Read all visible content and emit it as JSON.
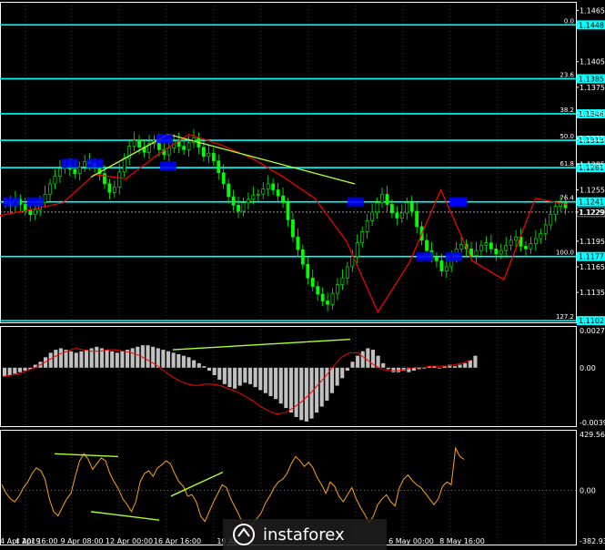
{
  "chart_data": [
    {
      "type": "candlestick",
      "ylim": [
        1.11,
        1.1475
      ],
      "price_ticks": [
        "1.1465",
        "1.1405",
        "1.1375",
        "1.1345",
        "1.1315",
        "1.1285",
        "1.1255",
        "1.1229",
        "1.1195",
        "1.1165",
        "1.1135"
      ],
      "fib_levels": [
        {
          "label": "0.0",
          "value": 1.1448,
          "price": "1.1448"
        },
        {
          "label": "23.6",
          "value": 1.1385,
          "price": "1.1385"
        },
        {
          "label": "38.2",
          "value": 1.1344,
          "price": "1.1344"
        },
        {
          "label": "50.0",
          "value": 1.1313,
          "price": "1.1313"
        },
        {
          "label": "61.8",
          "value": 1.1281,
          "price": "1.1281"
        },
        {
          "label": "76.4",
          "value": 1.1241,
          "price": "1.1241"
        },
        {
          "label": "100.0",
          "value": 1.1177,
          "price": "1.1177"
        },
        {
          "label": "127.2",
          "value": 1.1102,
          "price": "1.1102"
        }
      ],
      "current_price": {
        "value": 1.1229,
        "label": "1.1229"
      },
      "close_series": [
        1.124,
        1.1236,
        1.1244,
        1.1238,
        1.1231,
        1.1226,
        1.1232,
        1.124,
        1.125,
        1.1262,
        1.1271,
        1.128,
        1.1284,
        1.1279,
        1.1274,
        1.1282,
        1.1288,
        1.1286,
        1.1281,
        1.1274,
        1.1262,
        1.1252,
        1.1258,
        1.1276,
        1.1292,
        1.1306,
        1.1313,
        1.1305,
        1.1299,
        1.1309,
        1.1313,
        1.1302,
        1.1296,
        1.1304,
        1.1312,
        1.1306,
        1.1302,
        1.131,
        1.1316,
        1.1305,
        1.1294,
        1.1298,
        1.1289,
        1.1275,
        1.1262,
        1.1247,
        1.1237,
        1.123,
        1.124,
        1.1244,
        1.1249,
        1.125,
        1.1256,
        1.1262,
        1.1255,
        1.1248,
        1.124,
        1.122,
        1.12,
        1.1185,
        1.1168,
        1.1152,
        1.1142,
        1.1133,
        1.1125,
        1.1121,
        1.1134,
        1.1144,
        1.1152,
        1.1165,
        1.1177,
        1.1193,
        1.1206,
        1.1219,
        1.1229,
        1.124,
        1.125,
        1.1238,
        1.1228,
        1.1222,
        1.1228,
        1.124,
        1.123,
        1.1212,
        1.1196,
        1.1184,
        1.1176,
        1.1172,
        1.116,
        1.1165,
        1.1178,
        1.1186,
        1.1191,
        1.1186,
        1.1178,
        1.1184,
        1.119,
        1.1193,
        1.1186,
        1.118,
        1.1184,
        1.119,
        1.1196,
        1.12,
        1.1189,
        1.1186,
        1.1192,
        1.1198,
        1.1204,
        1.1214,
        1.1226,
        1.1236,
        1.124,
        1.1234
      ],
      "zigzag": [
        1.1225,
        1.1232,
        1.124,
        1.1273,
        1.1268,
        1.1296,
        1.132,
        1.1308,
        1.1292,
        1.127,
        1.1245,
        1.1195,
        1.1112,
        1.117,
        1.1255,
        1.1172,
        1.115,
        1.1245,
        1.1238
      ],
      "trend_lines": [
        {
          "from": [
            1.127
          ],
          "to": [
            1.132
          ]
        },
        {
          "from": [
            1.132
          ],
          "to": [
            1.1262
          ]
        }
      ],
      "markers": [
        {
          "value": 1.1241
        },
        {
          "value": 1.1241
        },
        {
          "value": 1.1286
        },
        {
          "value": 1.1286
        },
        {
          "value": 1.1315
        },
        {
          "value": 1.1283
        },
        {
          "value": 1.1241
        },
        {
          "value": 1.1241
        },
        {
          "value": 1.1177
        },
        {
          "value": 1.1177
        },
        {
          "value": 1.1241
        }
      ]
    },
    {
      "type": "histogram",
      "name": "MACD",
      "ylim": [
        -0.00391,
        0.00279
      ],
      "ticks": [
        "0.00279",
        "0.00",
        "-0.00391"
      ],
      "values": [
        -0.0006,
        -0.0005,
        -0.0004,
        -0.0003,
        -0.0002,
        -0.0001,
        0.0002,
        0.0004,
        0.0007,
        0.001,
        0.0012,
        0.0013,
        0.0012,
        0.0011,
        0.001,
        0.0011,
        0.0012,
        0.0013,
        0.0014,
        0.0013,
        0.0012,
        0.0011,
        0.001,
        0.0011,
        0.0012,
        0.0013,
        0.0014,
        0.0015,
        0.0015,
        0.0014,
        0.0013,
        0.0012,
        0.0011,
        0.001,
        0.0009,
        0.0008,
        0.0007,
        0.0005,
        0.0003,
        0.0001,
        -0.0002,
        -0.0005,
        -0.0008,
        -0.0011,
        -0.0013,
        -0.0014,
        -0.0012,
        -0.001,
        -0.0011,
        -0.0013,
        -0.0015,
        -0.0017,
        -0.0019,
        -0.0021,
        -0.0024,
        -0.0027,
        -0.003,
        -0.0033,
        -0.0035,
        -0.0036,
        -0.0034,
        -0.003,
        -0.0026,
        -0.0022,
        -0.0017,
        -0.0012,
        -0.0007,
        -0.0002,
        0.0004,
        0.0008,
        0.0011,
        0.0013,
        0.0012,
        0.0008,
        0.0003,
        -0.0001,
        -0.0003,
        -0.0003,
        -0.0002,
        -0.0003,
        -0.0002,
        -0.0001,
        0.0,
        0.0001,
        0.0001,
        0.0,
        0.0001,
        0.0002,
        0.0001,
        0.0002,
        0.0003,
        0.0005,
        0.0008
      ],
      "signal": [
        -0.0006,
        -0.0005,
        -0.0004,
        -0.0002,
        0.0,
        0.0003,
        0.0006,
        0.0009,
        0.0011,
        0.0013,
        0.0012,
        0.0011,
        0.0011,
        0.0012,
        0.0012,
        0.0011,
        0.001,
        0.0008,
        0.0005,
        0.0002,
        -0.0002,
        -0.0006,
        -0.0009,
        -0.0011,
        -0.0012,
        -0.0011,
        -0.0011,
        -0.0012,
        -0.0014,
        -0.0016,
        -0.0019,
        -0.0022,
        -0.0026,
        -0.0029,
        -0.0031,
        -0.003,
        -0.0027,
        -0.0023,
        -0.0018,
        -0.0012,
        -0.0006,
        0.0001,
        0.0007,
        0.001,
        0.001,
        0.0006,
        0.0002,
        -0.0001,
        -0.0002,
        -0.0002,
        -0.0001,
        0.0,
        0.0,
        0.0001,
        0.0001,
        0.0001,
        0.0002,
        0.0003,
        0.0005
      ]
    },
    {
      "type": "line",
      "name": "CCI",
      "ylim": [
        -382.939,
        429.56
      ],
      "ticks": [
        "429.56",
        "0.00",
        "-382.939"
      ],
      "values": [
        40,
        -20,
        -60,
        -80,
        -40,
        20,
        60,
        120,
        160,
        140,
        80,
        -60,
        -150,
        -180,
        -120,
        -60,
        -20,
        100,
        210,
        260,
        220,
        150,
        190,
        230,
        210,
        120,
        60,
        10,
        -60,
        -100,
        -150,
        -80,
        60,
        120,
        140,
        100,
        160,
        180,
        210,
        190,
        120,
        60,
        30,
        -40,
        -30,
        -80,
        -180,
        -220,
        -150,
        -80,
        -20,
        40,
        20,
        -60,
        -120,
        -180,
        -260,
        -300,
        -240,
        -200,
        -160,
        -90,
        -40,
        20,
        60,
        80,
        120,
        190,
        240,
        210,
        170,
        200,
        160,
        90,
        40,
        -20,
        60,
        30,
        -40,
        -80,
        -30,
        20,
        -60,
        -120,
        -170,
        -230,
        -180,
        -100,
        -60,
        -30,
        -80,
        -110,
        20,
        80,
        110,
        70,
        40,
        20,
        -20,
        -60,
        -100,
        -60,
        30,
        60,
        40,
        300,
        240,
        220
      ],
      "trend_lines": [
        {
          "from": [
            260
          ],
          "to": [
            240
          ]
        },
        {
          "from": [
            -150
          ],
          "to": [
            -210
          ]
        },
        {
          "from": [
            -40
          ],
          "to": [
            130
          ]
        }
      ]
    }
  ],
  "x_ticks": [
    "4 Apr 2019",
    "4 Apr 16:00",
    "9 Apr 08:00",
    "12 Apr 00:00",
    "16 Apr 16:00",
    "19 Ap",
    "6 May 00:00",
    "8 May 16:00"
  ],
  "logo": {
    "text": "instaforex"
  },
  "colors": {
    "background": "#000000",
    "grid": "#ffffff",
    "fib_line": "#00ffff",
    "candle": "#00ff00",
    "zigzag": "#ff0000",
    "trend": "#adff2f",
    "marker": "#0000ff",
    "histogram": "#c0c0c0",
    "signal": "#ff0000",
    "cci": "#ffa500"
  }
}
